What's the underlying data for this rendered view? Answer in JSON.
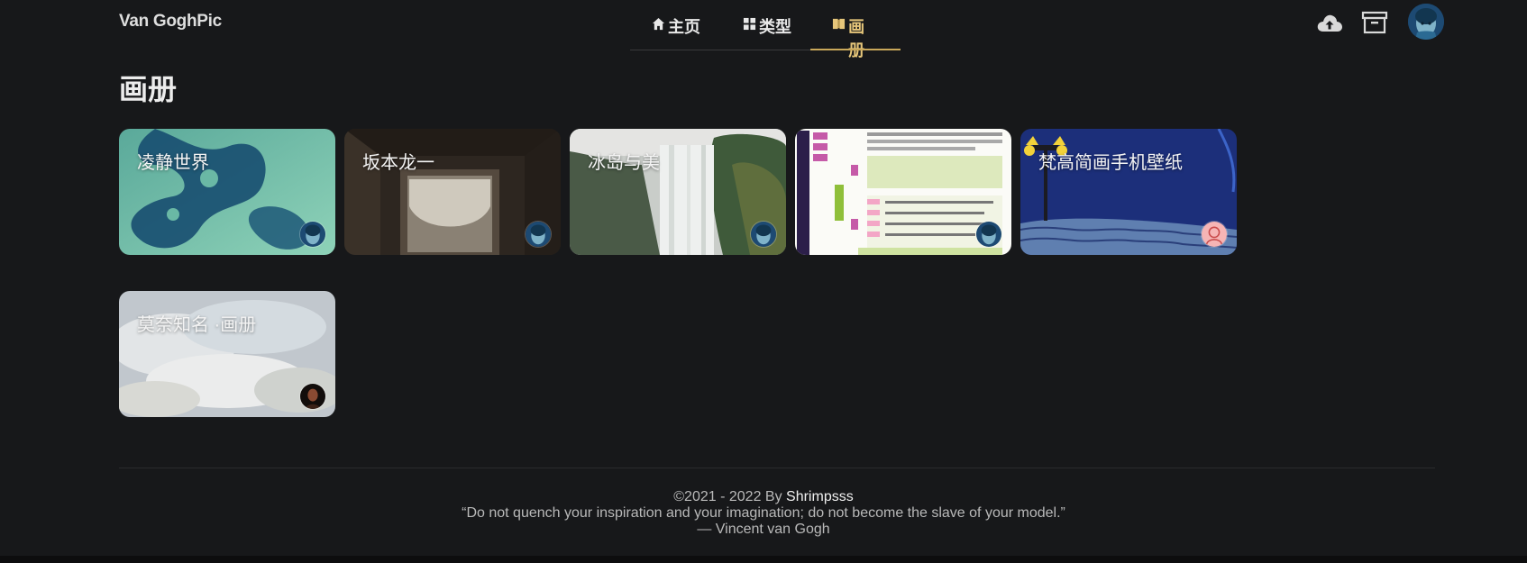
{
  "brand": "Van GoghPic",
  "nav": [
    {
      "label": "主页",
      "icon": "home-icon"
    },
    {
      "label": "类型",
      "icon": "grid-icon"
    },
    {
      "label": "画册",
      "icon": "album-icon",
      "active": true
    }
  ],
  "header_icons": [
    "cloud-upload-icon",
    "archive-icon",
    "user-avatar"
  ],
  "page": {
    "title": "画册"
  },
  "albums": [
    {
      "title": "凌静世界",
      "owner": "user-avatar"
    },
    {
      "title": "坂本龙一",
      "owner": "user-avatar"
    },
    {
      "title": "冰岛与美",
      "owner": "user-avatar"
    },
    {
      "title": "",
      "owner": "user-avatar"
    },
    {
      "title": "梵高简画手机壁纸",
      "owner": "pink-avatar"
    },
    {
      "title": "莫奈知名 ·画册",
      "owner": "portrait-avatar"
    }
  ],
  "footer": {
    "copyright": "©2021 - 2022 By",
    "author": "Shrimpsss",
    "quote": "“Do not quench your inspiration and your imagination; do not become the slave of your model.”",
    "attribution": "— Vincent van Gogh"
  },
  "colors": {
    "background": "#17181a",
    "accent": "#e6c67a",
    "text": "#e6e6e6"
  }
}
